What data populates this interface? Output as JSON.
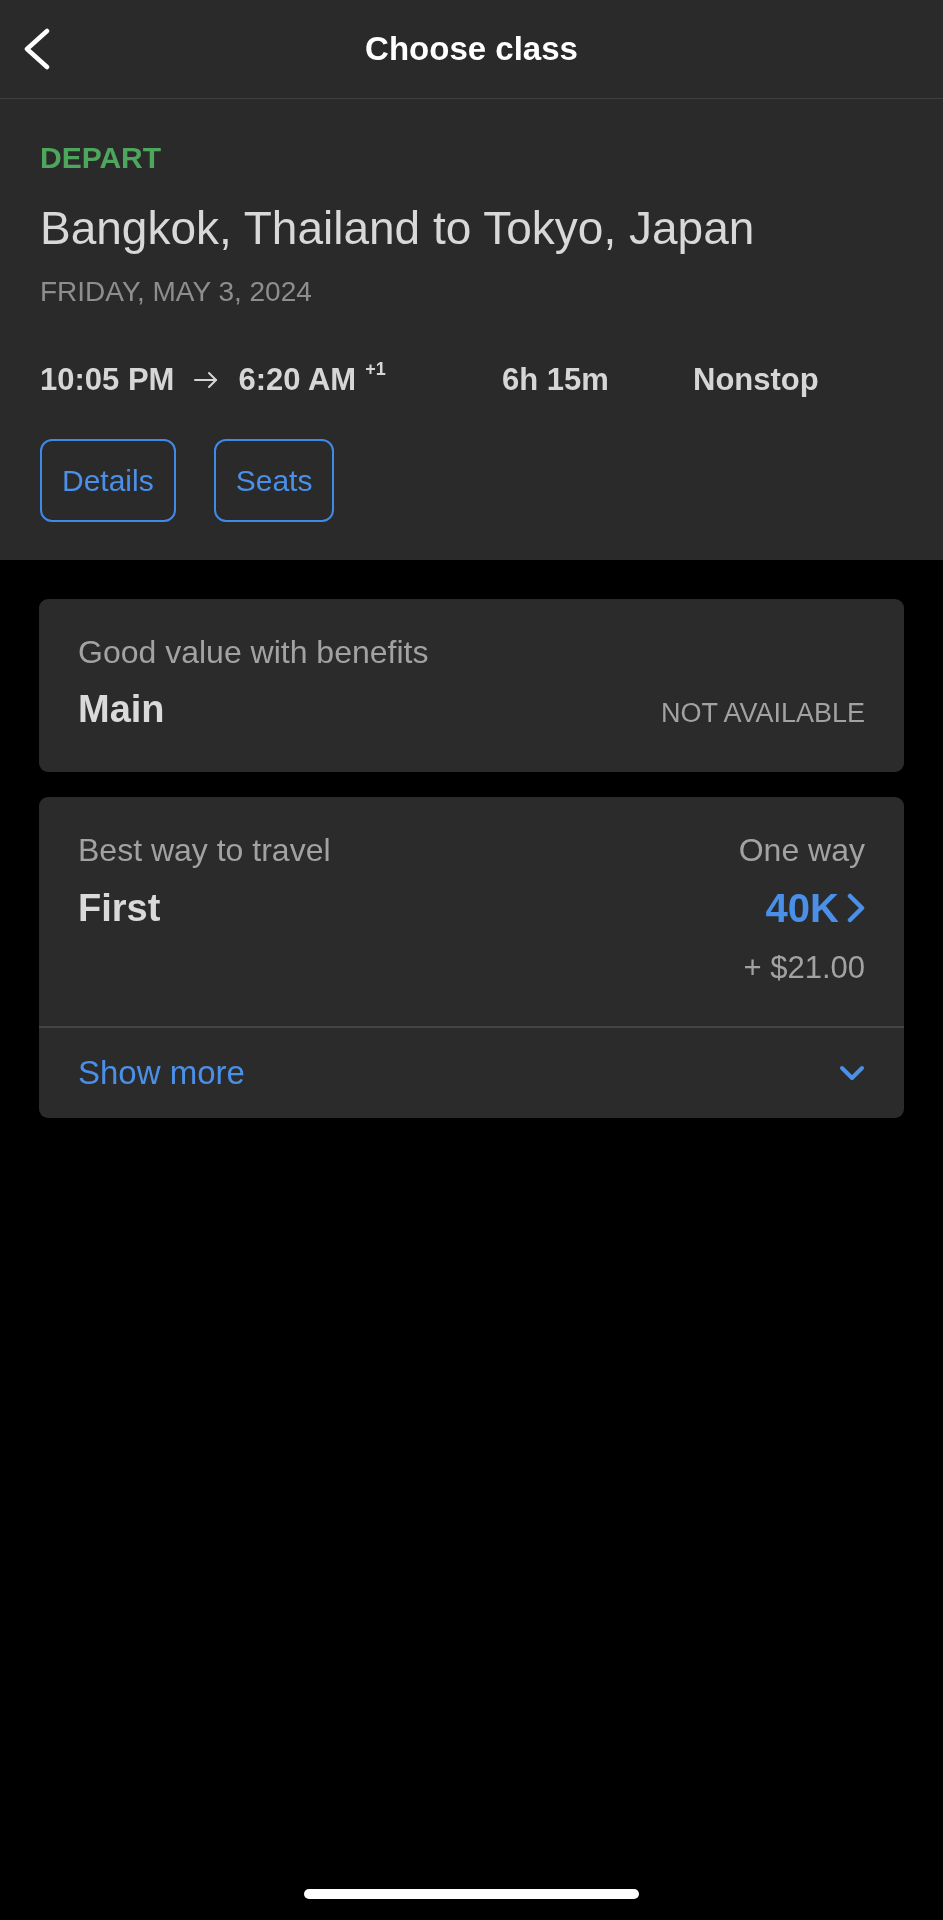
{
  "header": {
    "title": "Choose class"
  },
  "flight": {
    "label": "DEPART",
    "route": "Bangkok, Thailand to Tokyo, Japan",
    "date": "FRIDAY, MAY 3, 2024",
    "departure_time": "10:05 PM",
    "arrival_time": "6:20 AM",
    "day_offset": "+1",
    "duration": "6h 15m",
    "stops": "Nonstop",
    "buttons": [
      "Details",
      "Seats"
    ]
  },
  "fare_classes": [
    {
      "kind": "unavailable",
      "tagline": "Good value with benefits",
      "name": "Main",
      "status": "NOT AVAILABLE"
    },
    {
      "kind": "available",
      "tagline": "Best way to travel",
      "name": "First",
      "trip_type": "One way",
      "price": "40K",
      "fees": "+ $21.00",
      "show_more": "Show more",
      "expanded": false
    }
  ]
}
